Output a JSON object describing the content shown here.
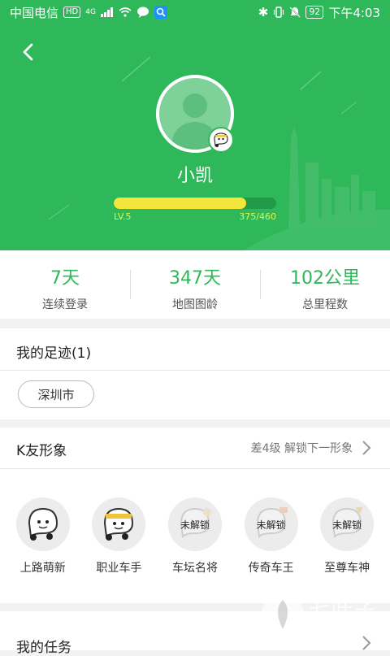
{
  "status_bar": {
    "carrier": "中国电信",
    "hd": "HD",
    "network": "4G",
    "battery": "92",
    "time": "下午4:03"
  },
  "profile": {
    "name": "小凯",
    "level": "LV.5",
    "exp_text": "375/460",
    "exp_fraction": 0.815
  },
  "stats": [
    {
      "value": "7天",
      "label": "连续登录"
    },
    {
      "value": "347天",
      "label": "地图图龄"
    },
    {
      "value": "102公里",
      "label": "总里程数"
    }
  ],
  "footprint": {
    "title": "我的足迹(1)",
    "cities": [
      "深圳市"
    ]
  },
  "k_friend": {
    "title": "K友形象",
    "unlock_hint": "差4级 解锁下一形象",
    "locked_text": "未解锁",
    "images": [
      {
        "label": "上路萌新",
        "locked": false
      },
      {
        "label": "职业车手",
        "locked": false
      },
      {
        "label": "车坛名将",
        "locked": true
      },
      {
        "label": "传奇车王",
        "locked": true
      },
      {
        "label": "至尊车神",
        "locked": true
      }
    ]
  },
  "tasks": {
    "title": "我的任务"
  },
  "watermark": {
    "name": "七叶子",
    "domain": "7YZ.COM"
  },
  "colors": {
    "brand_green": "#2fb85a",
    "exp_yellow": "#f4e53a"
  }
}
